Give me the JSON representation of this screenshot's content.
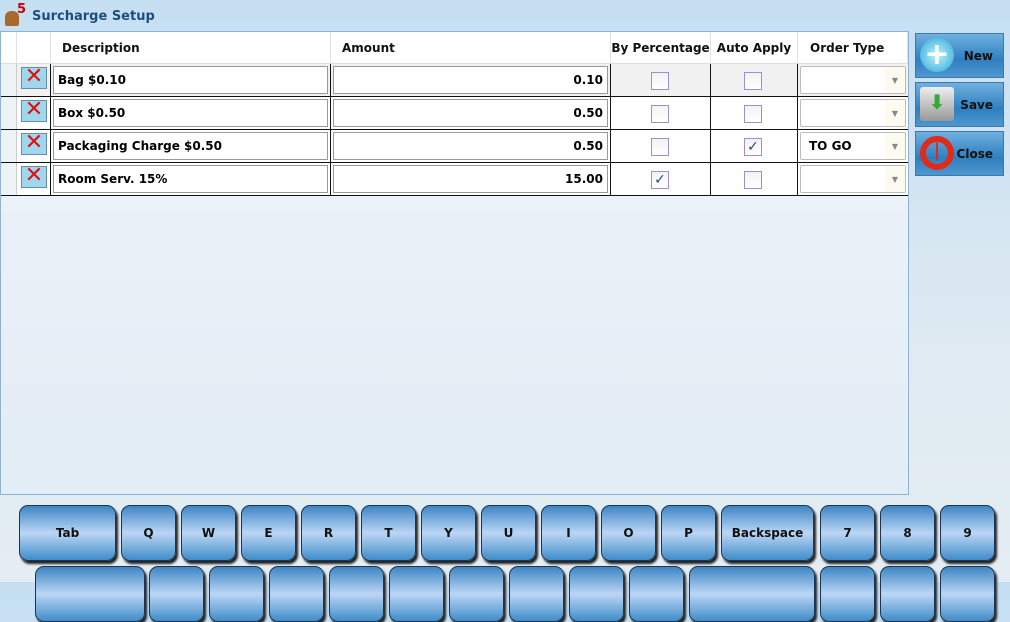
{
  "window": {
    "title": "Surcharge Setup"
  },
  "grid": {
    "columns": [
      "Description",
      "Amount",
      "By Percentage",
      "Auto Apply",
      "Order Type"
    ],
    "rows": [
      {
        "description": "Bag $0.10",
        "amount": "0.10",
        "by_percentage": false,
        "auto_apply": false,
        "order_type": ""
      },
      {
        "description": "Box $0.50",
        "amount": "0.50",
        "by_percentage": false,
        "auto_apply": false,
        "order_type": ""
      },
      {
        "description": "Packaging Charge $0.50",
        "amount": "0.50",
        "by_percentage": false,
        "auto_apply": true,
        "order_type": "TO GO"
      },
      {
        "description": "Room Serv. 15%",
        "amount": "15.00",
        "by_percentage": true,
        "auto_apply": false,
        "order_type": ""
      }
    ]
  },
  "actions": {
    "new": "New",
    "save": "Save",
    "close": "Close"
  },
  "keyboard": {
    "row1": [
      "Tab",
      "Q",
      "W",
      "E",
      "R",
      "T",
      "Y",
      "U",
      "I",
      "O",
      "P",
      "Backspace",
      "7",
      "8",
      "9"
    ],
    "row2": [
      "",
      "",
      "",
      "",
      "",
      "",
      "",
      "",
      "",
      "",
      "",
      "",
      "",
      "",
      ""
    ]
  }
}
